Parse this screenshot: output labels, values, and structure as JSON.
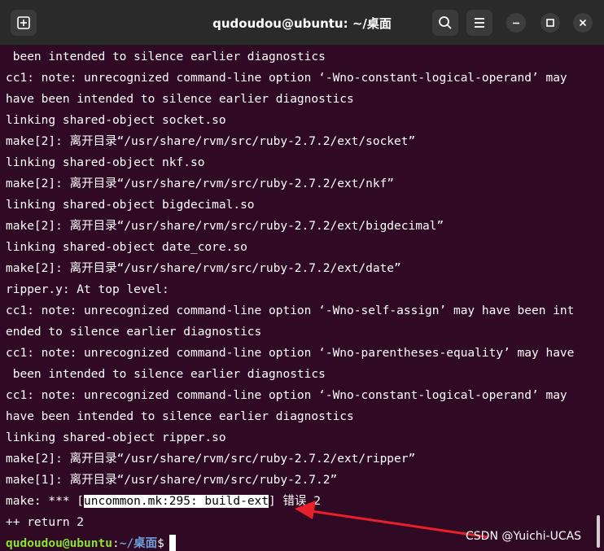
{
  "window": {
    "title": "qudoudou@ubuntu: ~/桌面",
    "icons": [
      "new-tab-icon",
      "search-icon",
      "menu-icon",
      "minimize-icon",
      "maximize-icon",
      "close-icon"
    ]
  },
  "terminal": {
    "lines": [
      " been intended to silence earlier diagnostics",
      "cc1: note: unrecognized command-line option ‘-Wno-constant-logical-operand’ may",
      "have been intended to silence earlier diagnostics",
      "linking shared-object socket.so",
      "make[2]: 离开目录“/usr/share/rvm/src/ruby-2.7.2/ext/socket”",
      "linking shared-object nkf.so",
      "make[2]: 离开目录“/usr/share/rvm/src/ruby-2.7.2/ext/nkf”",
      "linking shared-object bigdecimal.so",
      "make[2]: 离开目录“/usr/share/rvm/src/ruby-2.7.2/ext/bigdecimal”",
      "linking shared-object date_core.so",
      "make[2]: 离开目录“/usr/share/rvm/src/ruby-2.7.2/ext/date”",
      "ripper.y: At top level:",
      "cc1: note: unrecognized command-line option ‘-Wno-self-assign’ may have been int",
      "ended to silence earlier diagnostics",
      "cc1: note: unrecognized command-line option ‘-Wno-parentheses-equality’ may have",
      " been intended to silence earlier diagnostics",
      "cc1: note: unrecognized command-line option ‘-Wno-constant-logical-operand’ may",
      "have been intended to silence earlier diagnostics",
      "linking shared-object ripper.so",
      "make[2]: 离开目录“/usr/share/rvm/src/ruby-2.7.2/ext/ripper”",
      "make[1]: 离开目录“/usr/share/rvm/src/ruby-2.7.2”"
    ],
    "error_line": {
      "prefix": "make: *** [",
      "highlighted": "uncommon.mk:295: build-ext",
      "suffix": "] 错误 2"
    },
    "return_line": "++ return 2",
    "prompt": {
      "user": "qudoudou@ubuntu",
      "separator": ":",
      "path": "~/桌面",
      "symbol": "$"
    }
  },
  "annotation": {
    "arrow_color": "#e8202a"
  },
  "watermark": "CSDN @Yuichi-UCAS"
}
